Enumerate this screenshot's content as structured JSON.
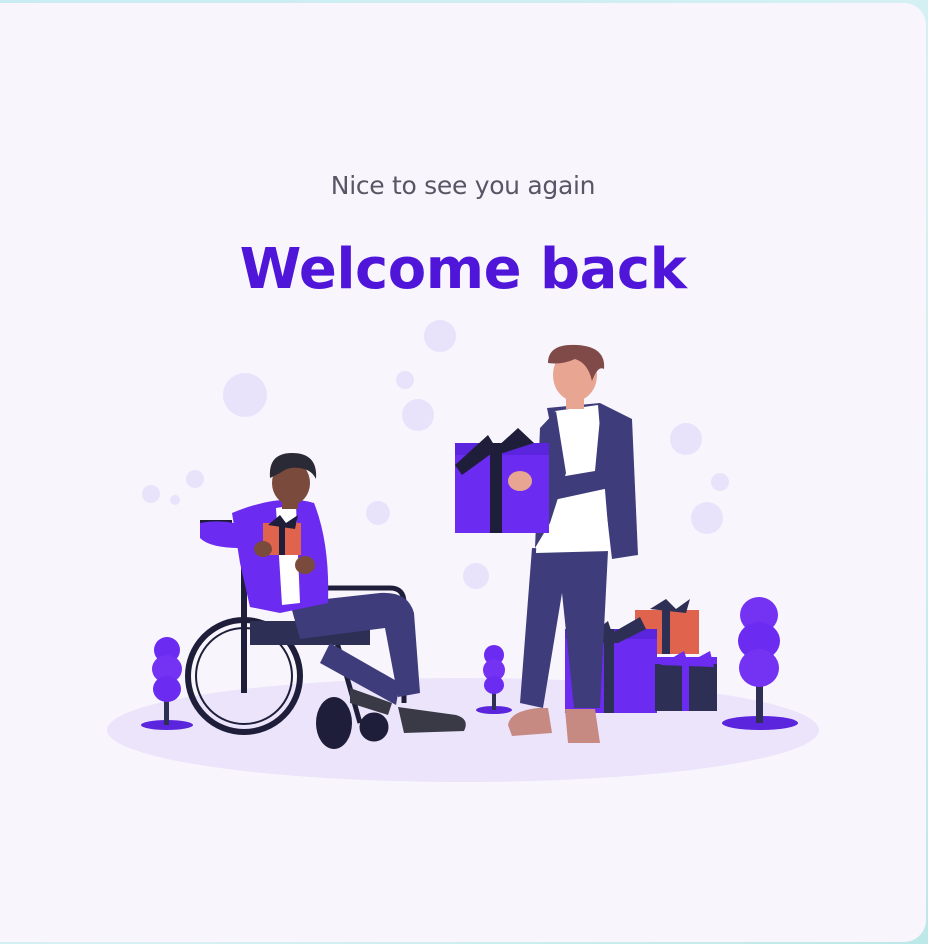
{
  "card": {
    "subtitle": "Nice to see you again",
    "title": "Welcome back"
  },
  "colors": {
    "accent": "#4f16d9",
    "card_background": "#f8f6fc",
    "subtitle_text": "#585664",
    "illustration_purple": "#6c2bf0",
    "illustration_navy": "#2e2f55",
    "illustration_lavender": "#ebe4fb"
  },
  "illustration": {
    "icon": "gift-exchange-illustration"
  }
}
